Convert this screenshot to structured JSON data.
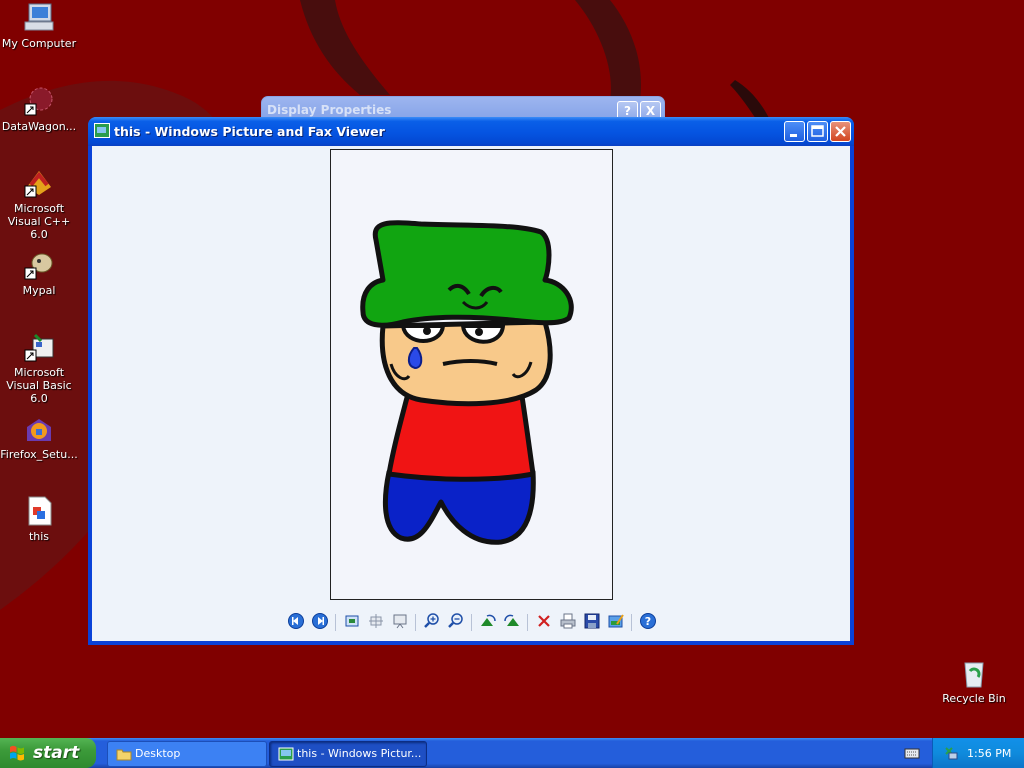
{
  "desktop": {
    "icons": [
      {
        "label": "My Computer",
        "icon": "my-computer-icon"
      },
      {
        "label": "DataWagon...",
        "icon": "datawagon-icon"
      },
      {
        "label": "Microsoft Visual C++ 6.0",
        "icon": "visual-cpp-icon"
      },
      {
        "label": "Mypal",
        "icon": "mypal-icon"
      },
      {
        "label": "Microsoft Visual Basic 6.0",
        "icon": "visual-basic-icon"
      },
      {
        "label": "Firefox_Setu...",
        "icon": "firefox-setup-icon"
      },
      {
        "label": "this",
        "icon": "image-file-icon"
      },
      {
        "label": "Recycle Bin",
        "icon": "recycle-bin-icon"
      }
    ],
    "background_color": "#800000"
  },
  "background_window": {
    "title": "Display Properties",
    "buttons": [
      "?",
      "X"
    ]
  },
  "viewer_window": {
    "title": "this - Windows Picture and Fax Viewer",
    "titlebar_buttons": [
      "minimize",
      "maximize",
      "close"
    ],
    "toolbar": [
      {
        "name": "previous-image-button",
        "icon": "previous-icon",
        "tooltip": "Previous Image"
      },
      {
        "name": "next-image-button",
        "icon": "next-icon",
        "tooltip": "Next Image"
      },
      {
        "name": "best-fit-button",
        "icon": "best-fit-icon",
        "tooltip": "Best Fit"
      },
      {
        "name": "actual-size-button",
        "icon": "actual-size-icon",
        "tooltip": "Actual Size"
      },
      {
        "name": "slideshow-button",
        "icon": "slideshow-icon",
        "tooltip": "Start Slide Show"
      },
      {
        "name": "zoom-in-button",
        "icon": "zoom-in-icon",
        "tooltip": "Zoom In"
      },
      {
        "name": "zoom-out-button",
        "icon": "zoom-out-icon",
        "tooltip": "Zoom Out"
      },
      {
        "name": "rotate-clockwise-button",
        "icon": "rotate-clockwise-icon",
        "tooltip": "Rotate Clockwise"
      },
      {
        "name": "rotate-counterclockwise-button",
        "icon": "rotate-counterclockwise-icon",
        "tooltip": "Rotate Counterclockwise"
      },
      {
        "name": "delete-button",
        "icon": "delete-icon",
        "tooltip": "Delete"
      },
      {
        "name": "print-button",
        "icon": "print-icon",
        "tooltip": "Print"
      },
      {
        "name": "copy-to-button",
        "icon": "save-icon",
        "tooltip": "Copy To"
      },
      {
        "name": "edit-button",
        "icon": "edit-icon",
        "tooltip": "Edit"
      },
      {
        "name": "help-button",
        "icon": "help-icon",
        "tooltip": "Help"
      }
    ]
  },
  "taskbar": {
    "start_label": "start",
    "tasks": [
      {
        "label": "Desktop",
        "icon": "folder-icon",
        "active": false
      },
      {
        "label": "this - Windows Pictur...",
        "icon": "picture-viewer-icon",
        "active": true
      }
    ],
    "clock": "1:56 PM"
  }
}
